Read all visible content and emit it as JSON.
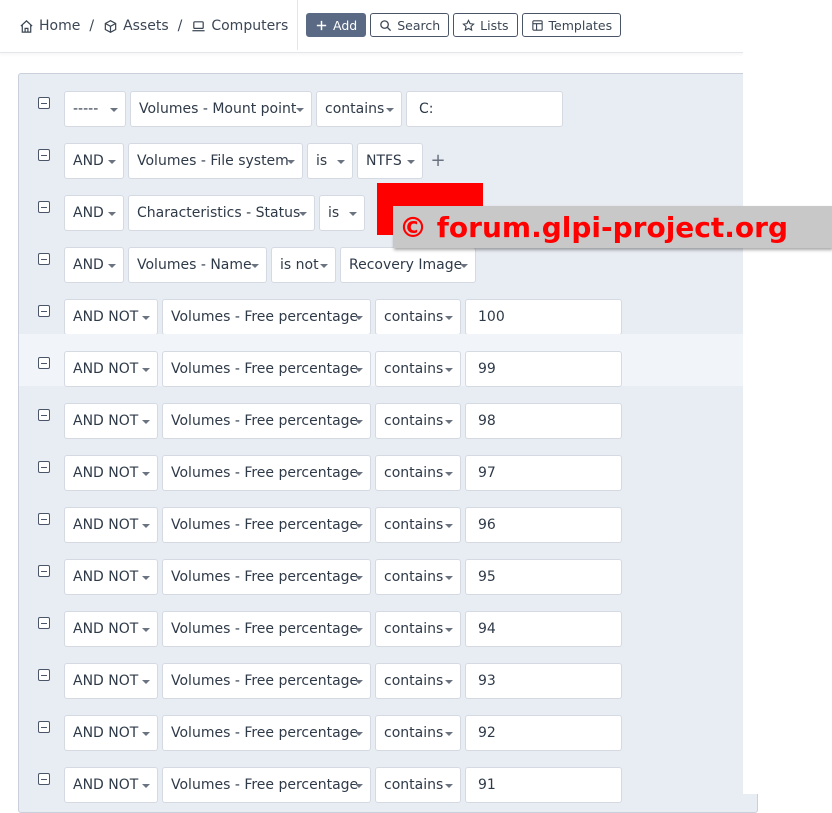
{
  "breadcrumb": [
    {
      "label": "Home",
      "icon": "home-icon"
    },
    {
      "label": "Assets",
      "icon": "cube-icon"
    },
    {
      "label": "Computers",
      "icon": "laptop-icon"
    }
  ],
  "breadcrumb_separator": "/",
  "toolbar": {
    "add": "Add",
    "search": "Search",
    "lists": "Lists",
    "templates": "Templates"
  },
  "criteria": [
    {
      "link": "-----",
      "field": "Volumes - Mount point",
      "operator": "contains",
      "value": "C:",
      "value_type": "input"
    },
    {
      "link": "AND",
      "field": "Volumes - File system",
      "operator": "is",
      "value": "NTFS",
      "value_type": "select",
      "plus": "+"
    },
    {
      "link": "AND",
      "field": "Characteristics - Status",
      "operator": "is",
      "value": "",
      "value_type": "redacted"
    },
    {
      "link": "AND",
      "field": "Volumes - Name",
      "operator": "is not",
      "value": "Recovery Image",
      "value_type": "select"
    },
    {
      "link": "AND NOT",
      "field": "Volumes - Free percentage",
      "operator": "contains",
      "value": "100",
      "value_type": "input"
    },
    {
      "link": "AND NOT",
      "field": "Volumes - Free percentage",
      "operator": "contains",
      "value": "99",
      "value_type": "input"
    },
    {
      "link": "AND NOT",
      "field": "Volumes - Free percentage",
      "operator": "contains",
      "value": "98",
      "value_type": "input"
    },
    {
      "link": "AND NOT",
      "field": "Volumes - Free percentage",
      "operator": "contains",
      "value": "97",
      "value_type": "input"
    },
    {
      "link": "AND NOT",
      "field": "Volumes - Free percentage",
      "operator": "contains",
      "value": "96",
      "value_type": "input"
    },
    {
      "link": "AND NOT",
      "field": "Volumes - Free percentage",
      "operator": "contains",
      "value": "95",
      "value_type": "input"
    },
    {
      "link": "AND NOT",
      "field": "Volumes - Free percentage",
      "operator": "contains",
      "value": "94",
      "value_type": "input"
    },
    {
      "link": "AND NOT",
      "field": "Volumes - Free percentage",
      "operator": "contains",
      "value": "93",
      "value_type": "input"
    },
    {
      "link": "AND NOT",
      "field": "Volumes - Free percentage",
      "operator": "contains",
      "value": "92",
      "value_type": "input"
    },
    {
      "link": "AND NOT",
      "field": "Volumes - Free percentage",
      "operator": "contains",
      "value": "91",
      "value_type": "input"
    }
  ],
  "watermark": "© forum.glpi-project.org",
  "colors": {
    "primary_button": "#5a6a85",
    "panel": "#e8ecf3",
    "watermark_text": "#ff0000"
  }
}
